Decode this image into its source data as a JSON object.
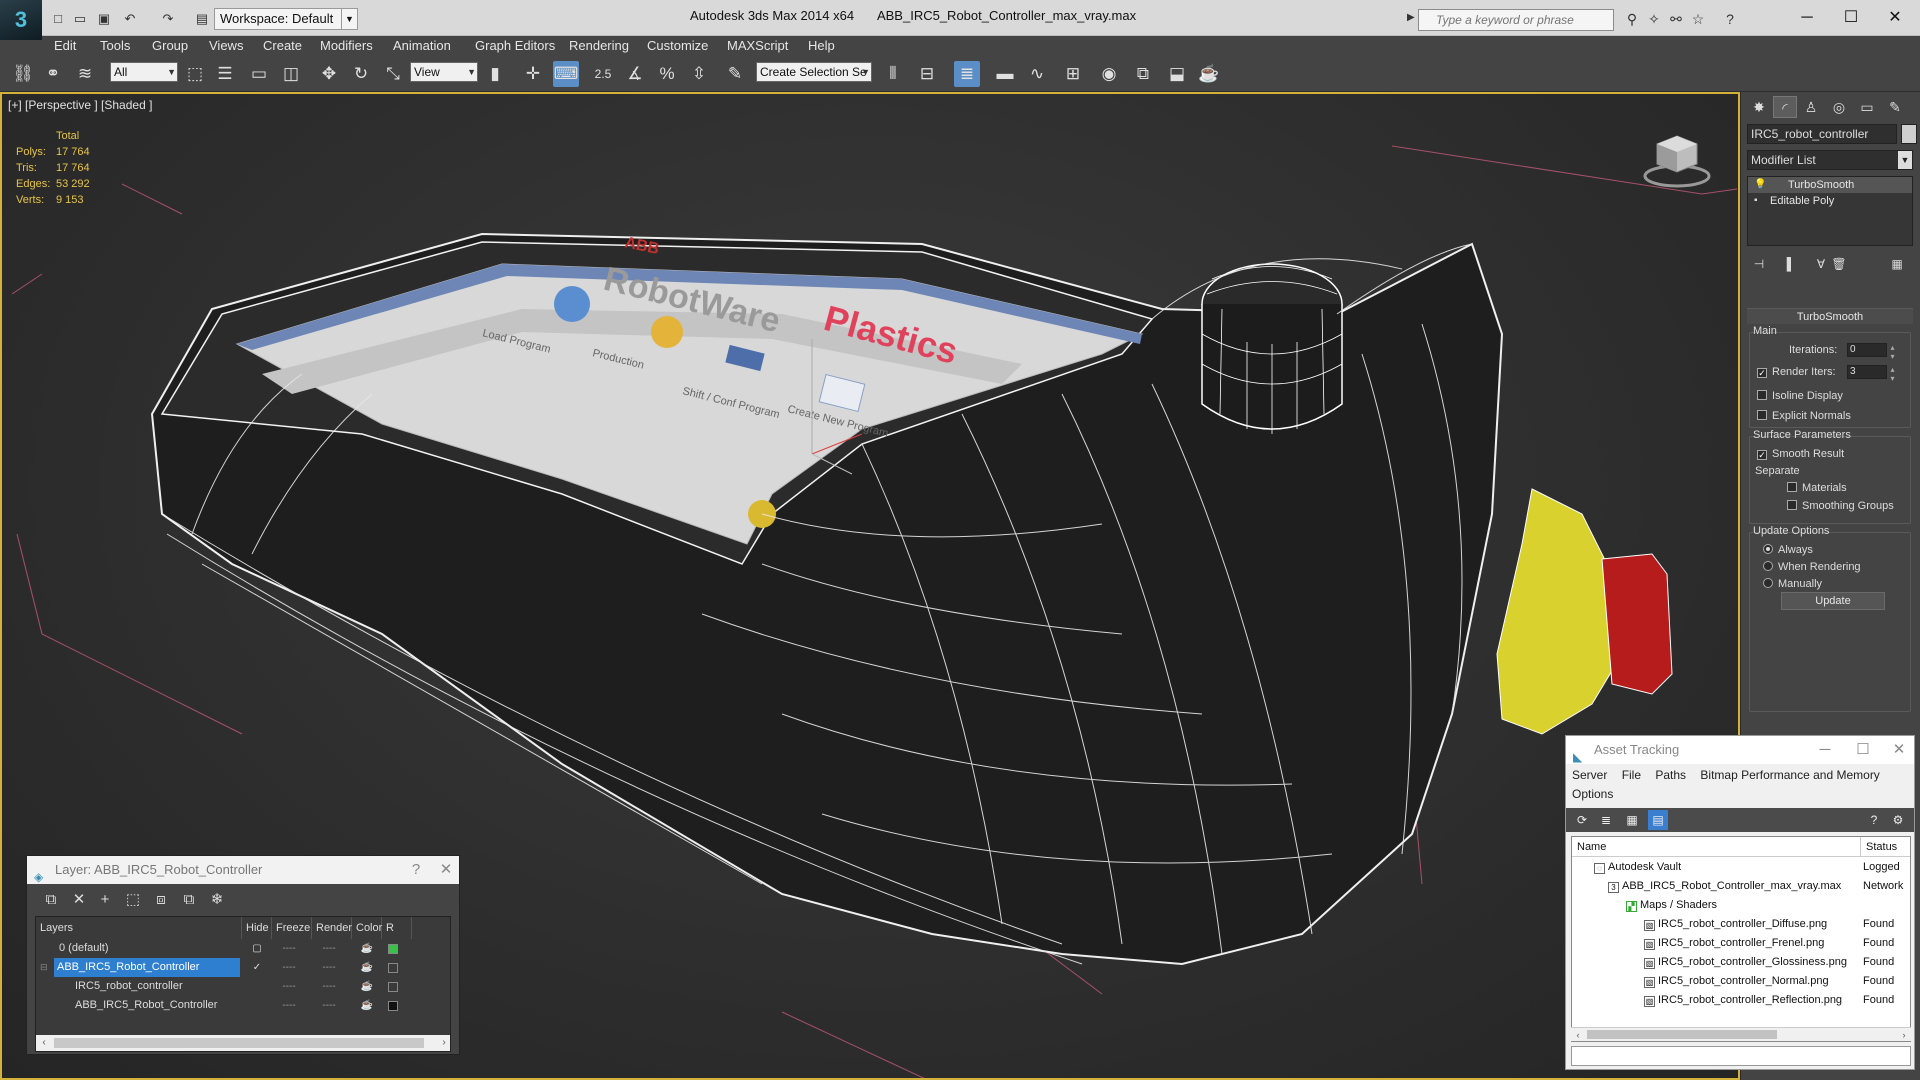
{
  "titlebar": {
    "workspace": "Workspace: Default",
    "app_name": "Autodesk 3ds Max  2014 x64",
    "file_name": "ABB_IRC5_Robot_Controller_max_vray.max",
    "search_placeholder": "Type a keyword or phrase"
  },
  "menu": [
    "Edit",
    "Tools",
    "Group",
    "Views",
    "Create",
    "Modifiers",
    "Animation",
    "Graph Editors",
    "Rendering",
    "Customize",
    "MAXScript",
    "Help"
  ],
  "toolbar": {
    "selection_filter": "All",
    "ref_coord": "View",
    "named_selection": "Create Selection Se",
    "snap_angle": "2.5",
    "percent": "%"
  },
  "viewport": {
    "label": "[+] [Perspective ] [Shaded ]",
    "stats": {
      "header": "Total",
      "rows": [
        {
          "label": "Polys:",
          "value": "17 764"
        },
        {
          "label": "Tris:",
          "value": "17 764"
        },
        {
          "label": "Edges:",
          "value": "53 292"
        },
        {
          "label": "Verts:",
          "value": "9 153"
        }
      ]
    },
    "screen_text": {
      "brand": "ABB",
      "heading": "RobotWare",
      "plastics": "Plastics",
      "icons": [
        "Load Program",
        "Production",
        "Shift / Conf Program",
        "Create New Program"
      ]
    }
  },
  "command_panel": {
    "object_name": "IRC5_robot_controller",
    "modifier_list": "Modifier List",
    "stack": [
      "TurboSmooth",
      "Editable Poly"
    ],
    "rollout_title": "TurboSmooth",
    "main_label": "Main",
    "iterations_label": "Iterations:",
    "iterations_value": "0",
    "render_iters_label": "Render Iters:",
    "render_iters_value": "3",
    "isoline": "Isoline Display",
    "explicit_normals": "Explicit Normals",
    "surface_params": "Surface Parameters",
    "smooth_result": "Smooth Result",
    "separate": "Separate",
    "materials": "Materials",
    "smoothing_groups": "Smoothing Groups",
    "update_options": "Update Options",
    "always": "Always",
    "when_rendering": "When Rendering",
    "manually": "Manually",
    "update_button": "Update",
    "colors": {
      "object_color": "#cfcfcf"
    }
  },
  "layer_window": {
    "title": "Layer: ABB_IRC5_Robot_Controller",
    "help": "?",
    "headers": [
      "Layers",
      "Hide",
      "Freeze",
      "Render",
      "Color",
      "R"
    ],
    "rows": [
      {
        "name": "0 (default)",
        "indent": 0,
        "color": "#38c24a",
        "selected": false
      },
      {
        "name": "ABB_IRC5_Robot_Controller",
        "indent": 0,
        "color": "#3a3a3a",
        "selected": true
      },
      {
        "name": "IRC5_robot_controller",
        "indent": 1,
        "color": "#3a3a3a",
        "selected": false
      },
      {
        "name": "ABB_IRC5_Robot_Controller",
        "indent": 1,
        "color": "#111111",
        "selected": false
      }
    ],
    "dash": "----"
  },
  "asset_window": {
    "title": "Asset Tracking",
    "menu": [
      "Server",
      "File",
      "Paths",
      "Bitmap Performance and Memory",
      "Options"
    ],
    "headers": [
      "Name",
      "Status"
    ],
    "rows": [
      {
        "name": "Autodesk Vault",
        "status": "Logged",
        "indent": 1
      },
      {
        "name": "ABB_IRC5_Robot_Controller_max_vray.max",
        "status": "Network",
        "indent": 2
      },
      {
        "name": "Maps / Shaders",
        "status": "",
        "indent": 3
      },
      {
        "name": "IRC5_robot_controller_Diffuse.png",
        "status": "Found",
        "indent": 4
      },
      {
        "name": "IRC5_robot_controller_Frenel.png",
        "status": "Found",
        "indent": 4
      },
      {
        "name": "IRC5_robot_controller_Glossiness.png",
        "status": "Found",
        "indent": 4
      },
      {
        "name": "IRC5_robot_controller_Normal.png",
        "status": "Found",
        "indent": 4
      },
      {
        "name": "IRC5_robot_controller_Reflection.png",
        "status": "Found",
        "indent": 4
      }
    ]
  },
  "colors": {
    "accent": "#5b8ec6",
    "stats_text": "#e7c443",
    "viewport_border": "#d4b23a",
    "estop_red": "#b61c1c",
    "enable_yellow": "#d9d12e",
    "selection_blue": "#2f7fd0"
  }
}
